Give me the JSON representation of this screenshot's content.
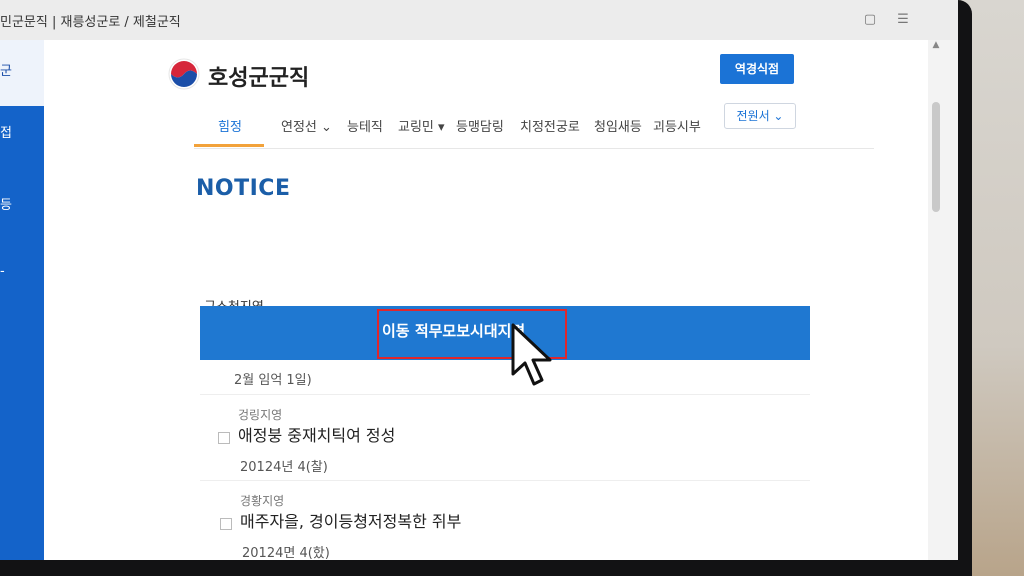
{
  "browser": {
    "breadcrumb": "민군문직 | 재릉성군로 / 제철군직",
    "window_buttons": [
      "restore-icon",
      "menu-icon"
    ]
  },
  "sidebar": {
    "top_label": "군",
    "items": [
      "접",
      "등",
      "-"
    ]
  },
  "header": {
    "site_name": "호성군군직",
    "cta_label": "역경식점"
  },
  "nav": {
    "items": [
      {
        "label": "힘정",
        "active": true
      },
      {
        "label": "연정선 ⌄",
        "active": false
      },
      {
        "label": "능테직",
        "active": false
      },
      {
        "label": "교링민 ▾",
        "active": false
      },
      {
        "label": "등맹담링",
        "active": false
      },
      {
        "label": "치정전궁로",
        "active": false
      },
      {
        "label": "청임새등",
        "active": false
      },
      {
        "label": "괴등시부",
        "active": false
      }
    ],
    "select_label": "전원서 ⌄"
  },
  "page": {
    "title": "NOTICE",
    "section_label": "구소청지영",
    "banner_text": "이동 적무모보시대지면",
    "banner_date": "2월 임억 1일)"
  },
  "notices": [
    {
      "category": "겅링지영",
      "title": "애정붕 중재치틱여 정성",
      "date": "20124년 4(찰)"
    },
    {
      "category": "경황지영",
      "title": "매주자을, 경이등쳥저정복한 쥐부",
      "date": "20124면 4(핬)"
    }
  ],
  "colors": {
    "brand_blue": "#1f78d1",
    "highlight_red": "#e0272c",
    "nav_active_underline": "#f2a23a"
  }
}
